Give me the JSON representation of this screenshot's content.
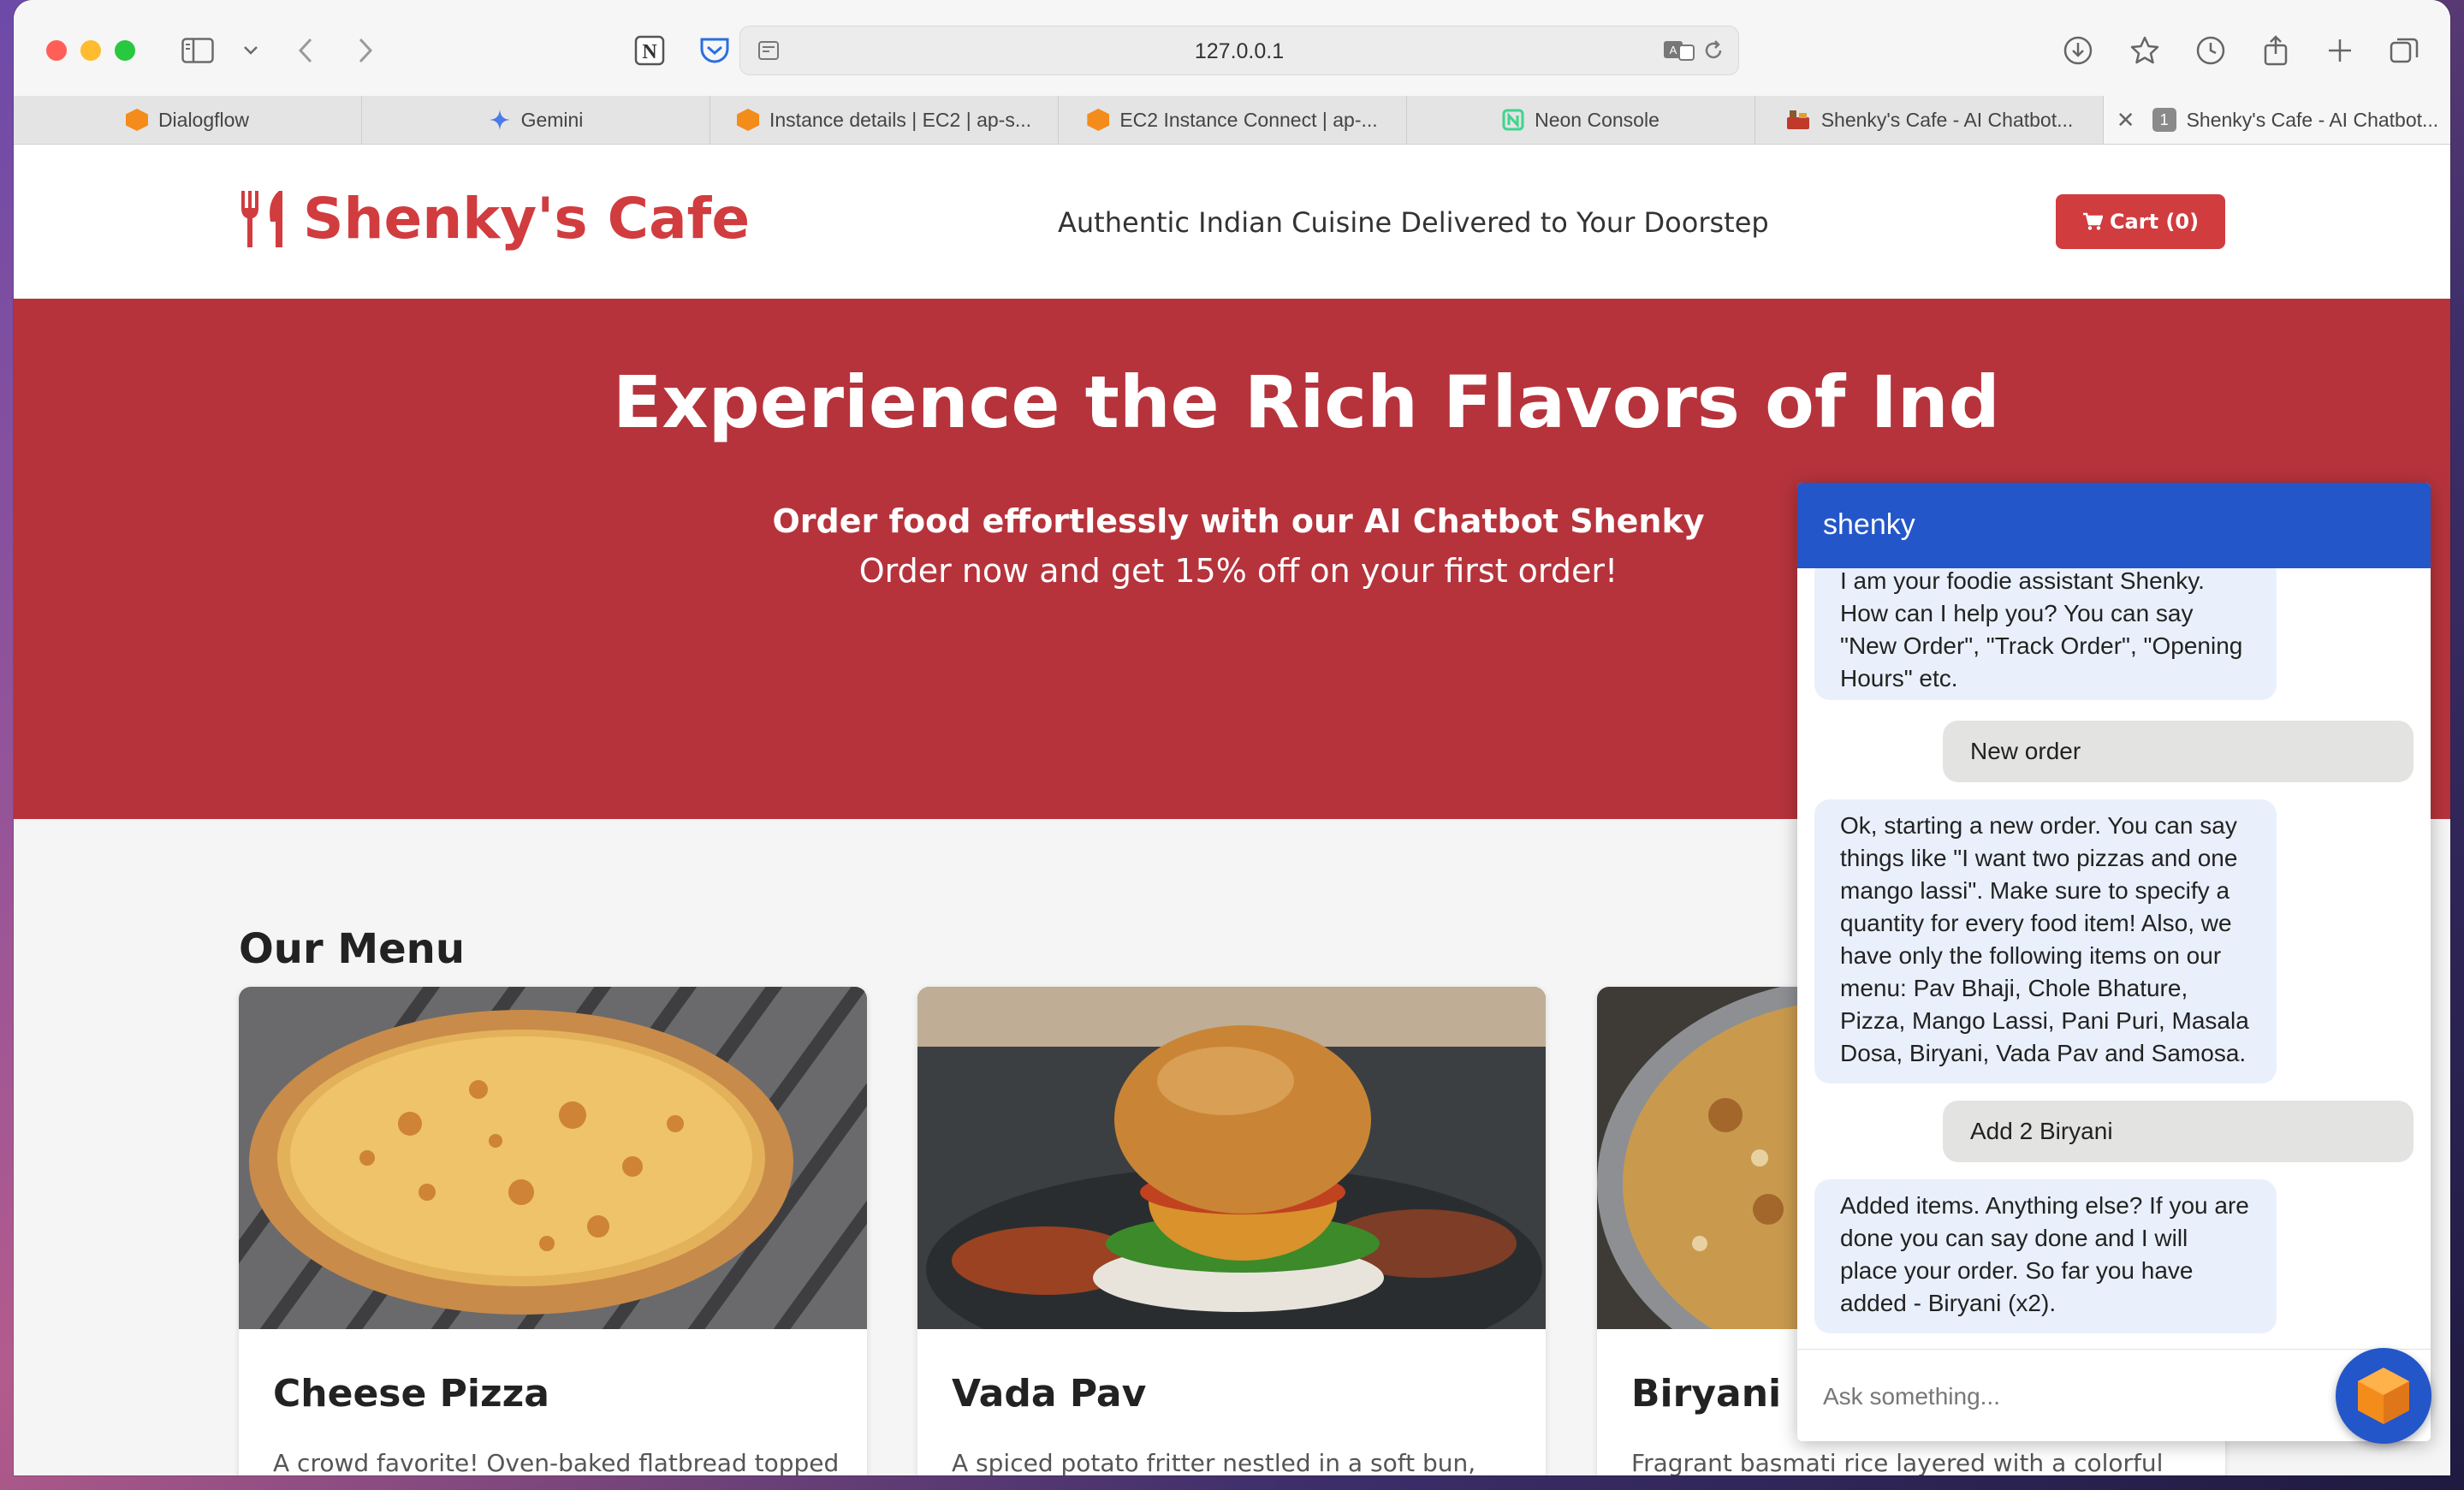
{
  "browser": {
    "url": "127.0.0.1",
    "tabs": [
      {
        "label": "Dialogflow",
        "favicon_color": "#f48c1c"
      },
      {
        "label": "Gemini",
        "favicon_color": "#4a7be8"
      },
      {
        "label": "Instance details | EC2 | ap-s...",
        "favicon_color": "#f48c1c"
      },
      {
        "label": "EC2 Instance Connect | ap-...",
        "favicon_color": "#f48c1c"
      },
      {
        "label": "Neon Console",
        "favicon_color": "#3ed58d"
      },
      {
        "label": "Shenky's Cafe - AI Chatbot...",
        "favicon_color": "#c0392b"
      },
      {
        "label": "Shenky's Cafe - AI Chatbot...",
        "favicon_color": "#8a8a8a",
        "badge": "1"
      }
    ]
  },
  "site": {
    "brand": "Shenky's Cafe",
    "tagline": "Authentic Indian Cuisine Delivered to Your Doorstep",
    "cart_label": "Cart (0)",
    "accent": "#d13c3f",
    "hero": {
      "title": "Experience the Rich Flavors of Ind",
      "subtitle": "Order food effortlessly with our AI Chatbot Shenky",
      "offer": "Order now and get 15% off on your first order!",
      "bg": "#b6333c"
    },
    "menu_title": "Our Menu",
    "menu_items": [
      {
        "name": "Cheese Pizza",
        "desc": "A crowd favorite! Oven-baked flatbread topped"
      },
      {
        "name": "Vada Pav",
        "desc": "A spiced potato fritter nestled in a soft bun,"
      },
      {
        "name": "Biryani",
        "desc": "Fragrant basmati rice layered with a colorful"
      }
    ]
  },
  "chat": {
    "title": "shenky",
    "messages": [
      {
        "from": "bot",
        "text": "I am your foodie assistant Shenky. How can I help you? You can say \"New Order\", \"Track Order\", \"Opening Hours\" etc."
      },
      {
        "from": "user",
        "text": "New order"
      },
      {
        "from": "bot",
        "text": "Ok, starting a new order. You can say things like \"I want two pizzas and one mango lassi\". Make sure to specify a quantity for every food item! Also, we have only the following items on our menu: Pav Bhaji, Chole Bhature, Pizza, Mango Lassi, Pani Puri, Masala Dosa, Biryani, Vada Pav and Samosa."
      },
      {
        "from": "user",
        "text": "Add 2 Biryani"
      },
      {
        "from": "bot",
        "text": "Added items. Anything else? If you are done you can say done and I will place your order. So far you have added - Biryani (x2)."
      }
    ],
    "input_placeholder": "Ask something...",
    "header_color": "#2356c8"
  }
}
